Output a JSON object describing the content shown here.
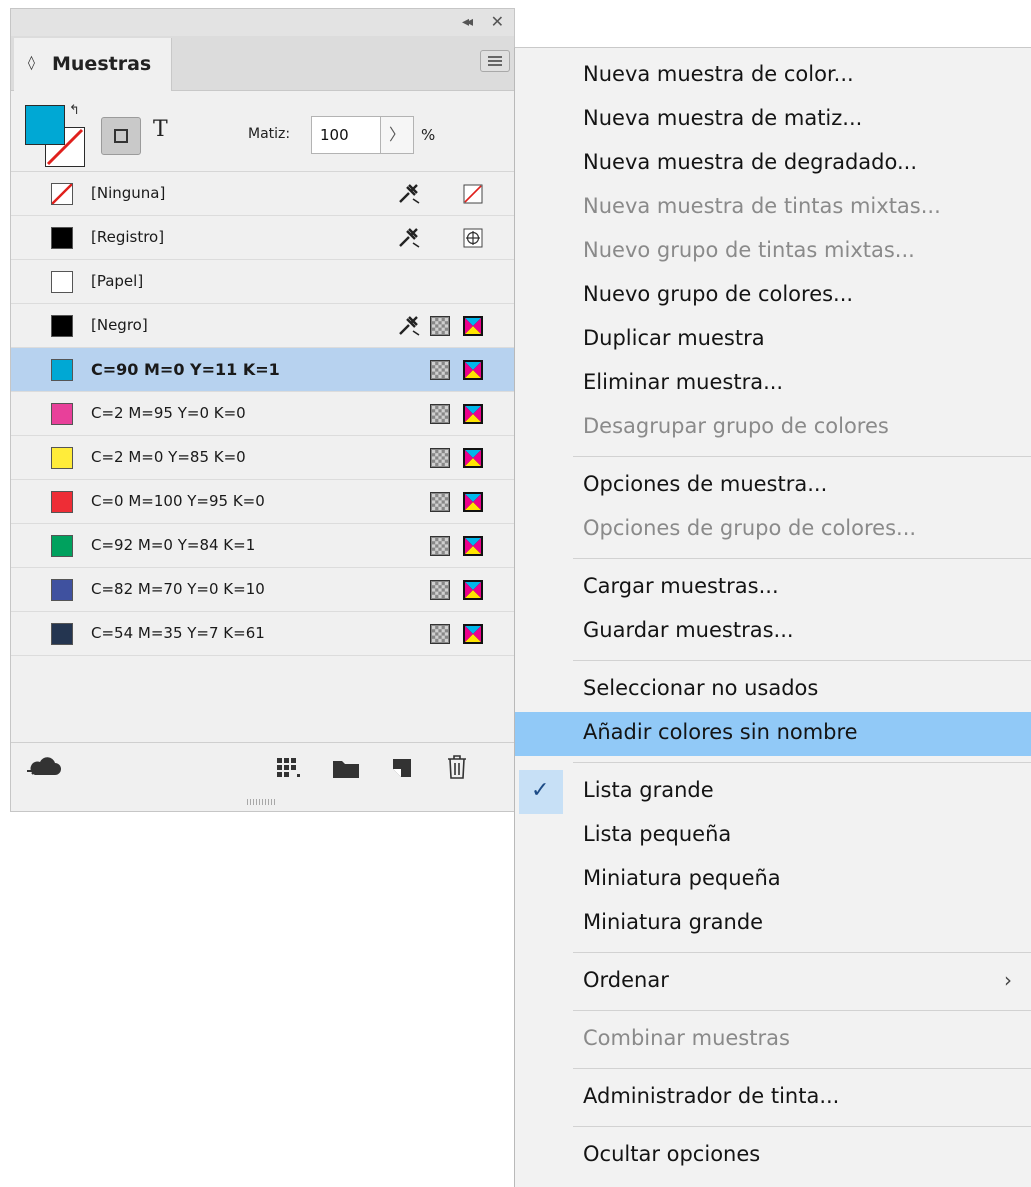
{
  "panel": {
    "tab_label": "Muestras",
    "tint": {
      "label": "Matiz:",
      "value": "100",
      "unit": "%"
    },
    "swatches": [
      {
        "name": "[Ninguna]",
        "color": "none",
        "lock": true,
        "type": "none-mark"
      },
      {
        "name": "[Registro]",
        "color": "#000000",
        "lock": true,
        "type": "registration"
      },
      {
        "name": "[Papel]",
        "color": "#ffffff",
        "lock": false,
        "type": ""
      },
      {
        "name": "[Negro]",
        "color": "#000000",
        "lock": true,
        "type": "cmyk"
      },
      {
        "name": "C=90 M=0 Y=11 K=1",
        "color": "#00a8d4",
        "lock": false,
        "type": "cmyk",
        "selected": true
      },
      {
        "name": "C=2 M=95 Y=0 K=0",
        "color": "#e8409a",
        "lock": false,
        "type": "cmyk"
      },
      {
        "name": "C=2 M=0 Y=85 K=0",
        "color": "#ffec3a",
        "lock": false,
        "type": "cmyk"
      },
      {
        "name": "C=0 M=100 Y=95 K=0",
        "color": "#ee2d36",
        "lock": false,
        "type": "cmyk"
      },
      {
        "name": "C=92 M=0 Y=84 K=1",
        "color": "#00a15e",
        "lock": false,
        "type": "cmyk"
      },
      {
        "name": "C=82 M=70 Y=0 K=10",
        "color": "#3f519f",
        "lock": false,
        "type": "cmyk"
      },
      {
        "name": "C=54 M=35 Y=7 K=61",
        "color": "#243550",
        "lock": false,
        "type": "cmyk"
      }
    ],
    "colors": {
      "fill": "#00a8d4",
      "selected_row": "#b7d2ef"
    }
  },
  "menu": {
    "items": [
      {
        "label": "Nueva muestra de color...",
        "enabled": true
      },
      {
        "label": "Nueva muestra de matiz...",
        "enabled": true
      },
      {
        "label": "Nueva muestra de degradado...",
        "enabled": true
      },
      {
        "label": "Nueva muestra de tintas mixtas...",
        "enabled": false
      },
      {
        "label": "Nuevo grupo de tintas mixtas...",
        "enabled": false
      },
      {
        "label": "Nuevo grupo de colores...",
        "enabled": true
      },
      {
        "label": "Duplicar muestra",
        "enabled": true
      },
      {
        "label": "Eliminar muestra...",
        "enabled": true
      },
      {
        "label": "Desagrupar grupo de colores",
        "enabled": false
      },
      {
        "label": "Opciones de muestra...",
        "enabled": true
      },
      {
        "label": "Opciones de grupo de colores...",
        "enabled": false
      },
      {
        "label": "Cargar muestras...",
        "enabled": true
      },
      {
        "label": "Guardar muestras...",
        "enabled": true
      },
      {
        "label": "Seleccionar no usados",
        "enabled": true
      },
      {
        "label": "Añadir colores sin nombre",
        "enabled": true,
        "highlighted": true
      },
      {
        "label": "Lista grande",
        "enabled": true,
        "checked": true
      },
      {
        "label": "Lista pequeña",
        "enabled": true
      },
      {
        "label": "Miniatura pequeña",
        "enabled": true
      },
      {
        "label": "Miniatura grande",
        "enabled": true
      },
      {
        "label": "Ordenar",
        "enabled": true,
        "submenu": true
      },
      {
        "label": "Combinar muestras",
        "enabled": false
      },
      {
        "label": "Administrador de tinta...",
        "enabled": true
      },
      {
        "label": "Ocultar opciones",
        "enabled": true
      }
    ],
    "colors": {
      "highlight": "#91c9f7",
      "disabled_text": "#8a8a8a"
    }
  }
}
